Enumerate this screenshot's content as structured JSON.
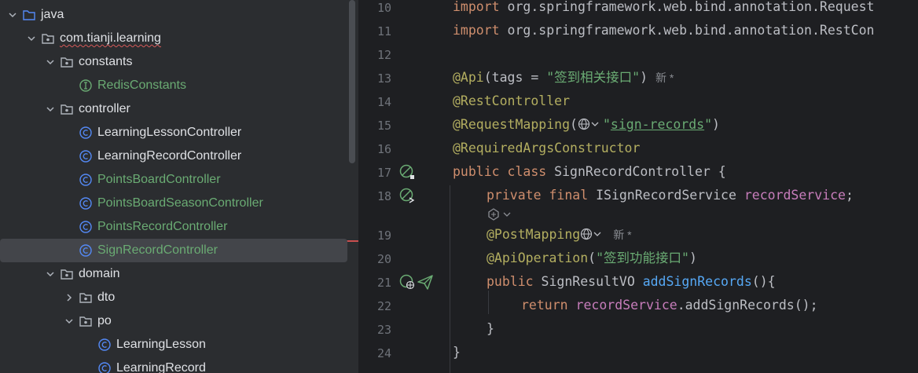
{
  "tree": {
    "rows": [
      {
        "label": "java"
      },
      {
        "label": "com.tianji.learning"
      },
      {
        "label": "constants"
      },
      {
        "label": "RedisConstants"
      },
      {
        "label": "controller"
      },
      {
        "label": "LearningLessonController"
      },
      {
        "label": "LearningRecordController"
      },
      {
        "label": "PointsBoardController"
      },
      {
        "label": "PointsBoardSeasonController"
      },
      {
        "label": "PointsRecordController"
      },
      {
        "label": "SignRecordController"
      },
      {
        "label": "domain"
      },
      {
        "label": "dto"
      },
      {
        "label": "po"
      },
      {
        "label": "LearningLesson"
      },
      {
        "label": "LearningRecord"
      }
    ]
  },
  "editor": {
    "line_numbers": [
      "10",
      "11",
      "12",
      "13",
      "14",
      "15",
      "16",
      "17",
      "18",
      "19",
      "20",
      "21",
      "22",
      "23",
      "24"
    ],
    "lines": {
      "l10_kw": "import",
      "l10_rest": " org.springframework.web.bind.annotation.Request",
      "l11_kw": "import",
      "l11_rest": " org.springframework.web.bind.annotation.RestCon",
      "l13_ann": "@Api",
      "l13_a": "(tags = ",
      "l13_str": "\"签到相关接口\"",
      "l13_b": ")",
      "l13_hint": "新 *",
      "l14_ann": "@RestController",
      "l15_ann": "@RequestMapping",
      "l15_a": "(",
      "l15_q1": "\"",
      "l15_path": "sign-records",
      "l15_q2": "\"",
      "l15_b": ")",
      "l16_ann": "@RequiredArgsConstructor",
      "l17_kw": "public class",
      "l17_rest": " SignRecordController {",
      "l18_kw": "private final",
      "l18_type": " ISignRecordService ",
      "l18_fld": "recordService",
      "l18_end": ";",
      "l19_ann": "@PostMapping",
      "l19_hint": "新 *",
      "l20_ann": "@ApiOperation",
      "l20_a": "(",
      "l20_str": "\"签到功能接口\"",
      "l20_b": ")",
      "l21_kw": "public",
      "l21_type": " SignResultVO ",
      "l21_fn": "addSignRecords",
      "l21_end": "(){",
      "l22_kw": "return",
      "l22_sp": " ",
      "l22_fld": "recordService",
      "l22_rest": ".addSignRecords();",
      "l23": "}",
      "l24": "}"
    }
  },
  "colors": {
    "tree_bg": "#2b2d30",
    "editor_bg": "#1e1f22",
    "keyword": "#cf8e6d",
    "annotation": "#b3ae60",
    "string": "#6aab73",
    "field": "#c77dbb",
    "method": "#56a8f5",
    "class_icon": "#548af7",
    "changed_file": "#6aab73"
  },
  "icons": [
    "chevron-down-icon",
    "chevron-right-icon",
    "folder-icon",
    "package-icon",
    "class-icon",
    "interface-icon",
    "bean-icon",
    "web-icon",
    "send-icon",
    "ai-icon"
  ]
}
